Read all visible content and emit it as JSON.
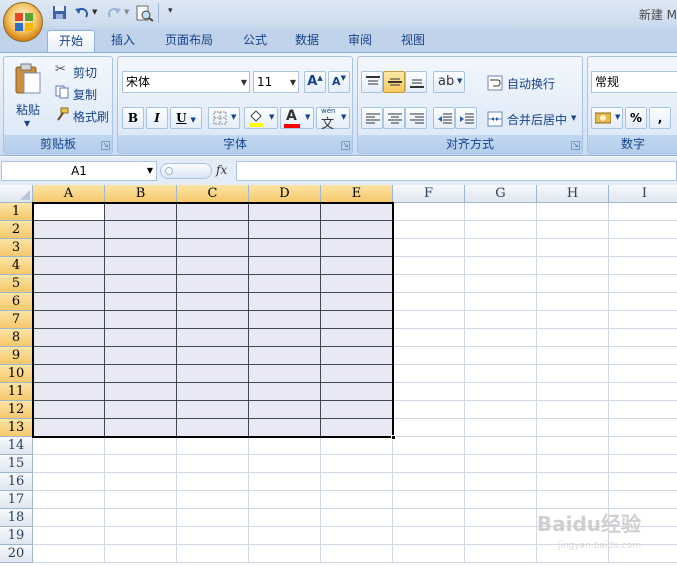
{
  "window": {
    "title": "新建 M"
  },
  "tabs": [
    "开始",
    "插入",
    "页面布局",
    "公式",
    "数据",
    "审阅",
    "视图"
  ],
  "clipboard": {
    "paste_label": "粘贴",
    "cut_label": "剪切",
    "copy_label": "复制",
    "format_painter_label": "格式刷",
    "group_label": "剪贴板"
  },
  "font": {
    "font_name": "宋体",
    "font_size": "11",
    "grow_label": "A",
    "shrink_label": "A",
    "bold_label": "B",
    "italic_label": "I",
    "underline_label": "U",
    "font_color_label": "A",
    "phonetic_label": "wén",
    "phonetic_char": "文",
    "group_label": "字体"
  },
  "alignment": {
    "wrap_text_label": "自动换行",
    "merge_center_label": "合并后居中",
    "group_label": "对齐方式"
  },
  "number": {
    "format": "常规",
    "percent_label": "%",
    "comma_label": ",",
    "group_label": "数字"
  },
  "formula_bar": {
    "name_box": "A1",
    "fx_label": "fx",
    "formula": ""
  },
  "sheet": {
    "columns": [
      "A",
      "B",
      "C",
      "D",
      "E",
      "F",
      "G",
      "H",
      "I"
    ],
    "rows": [
      "1",
      "2",
      "3",
      "4",
      "5",
      "6",
      "7",
      "8",
      "9",
      "10",
      "11",
      "12",
      "13",
      "14",
      "15",
      "16",
      "17",
      "18",
      "19",
      "20"
    ],
    "selected_columns": 5,
    "selected_rows": 13
  },
  "watermark": {
    "text": "Baidu经验",
    "sub": "jingyan.baidu.com"
  },
  "colors": {
    "ribbon": "#dbe7f5",
    "selection_fill": "#e9e9f5",
    "header_selected": "#f6c86b",
    "tab_text": "#15428b"
  }
}
